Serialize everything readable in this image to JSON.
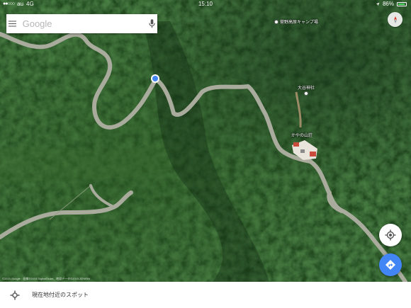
{
  "status_bar": {
    "signal": "●●○○○",
    "carrier": "au",
    "network": "4G",
    "time": "15:10",
    "battery_percent": "86%",
    "battery_level": 0.86,
    "location_arrow": "location-arrow-icon"
  },
  "search": {
    "placeholder": "Google",
    "menu_icon": "hamburger-menu-icon",
    "mic_icon": "microphone-icon"
  },
  "compass": {
    "icon": "compass-icon",
    "accent_color": "#d93025"
  },
  "map": {
    "style": "satellite",
    "road_color": "#a9ab9d",
    "current_location_color": "#4285f4",
    "labels": [
      {
        "id": "camp",
        "text": "菅野高原キャンプ場",
        "icon": "poi-dot"
      },
      {
        "id": "shrine",
        "text": "大谷神社",
        "icon": "poi-dot"
      },
      {
        "id": "lodge",
        "text": "かやの山荘",
        "icon": ""
      }
    ]
  },
  "controls": {
    "my_location_icon": "my-location-icon",
    "directions_icon": "directions-icon",
    "directions_color": "#4285f4"
  },
  "copyright": "©2015 Google · 画像©2015 DigitalGlobe、地図データ©2015 ZENRIN",
  "bottom_bar": {
    "icon": "explore-spots-icon",
    "text": "現在地付近のスポット"
  }
}
